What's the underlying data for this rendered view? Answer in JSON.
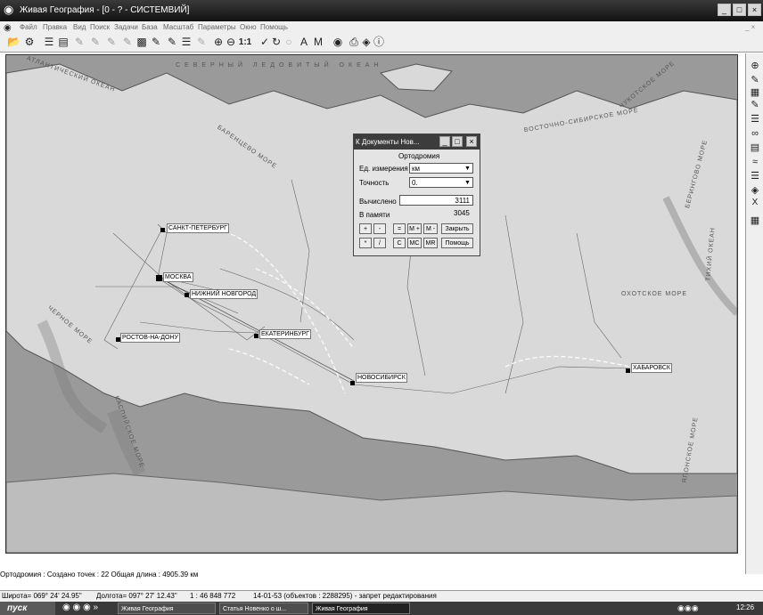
{
  "window": {
    "title": "Живая География - [0 - ? - СИСТЕМВИЙ]"
  },
  "menu": [
    "Файл",
    "Правка",
    "Вид",
    "Поиск",
    "Задачи",
    "База",
    "Масштаб",
    "Параметры",
    "Окно",
    "Помощь"
  ],
  "toolbar": {
    "zoom_label": "1:1"
  },
  "map": {
    "cities": [
      {
        "name": "САНКТ-ПЕТЕРБУРГ"
      },
      {
        "name": "МОСКВА"
      },
      {
        "name": "НИЖНИЙ НОВГОРОД"
      },
      {
        "name": "РОСТОВ-НА-ДОНУ"
      },
      {
        "name": "ЕКАТЕРИНБУРГ"
      },
      {
        "name": "НОВОСИБИРСК"
      },
      {
        "name": "ХАБАРОВСК"
      }
    ],
    "seas": [
      "АТЛАНТИЧЕСКИЙ ОКЕАН",
      "ВОСТОЧНО-СИБИРСКОЕ МОРЕ",
      "ОХОТСКОЕ МОРЕ",
      "ТИХИЙ ОКЕАН",
      "ЧУКОТСКОЕ МОРЕ",
      "БЕРИНГОВО МОРЕ",
      "ЧЕРНОЕ МОРЕ",
      "КАСПИЙСКОЕ МОРЕ",
      "ЯПОНСКОЕ МОРЕ",
      "СЕВЕРНЫЙ ЛЕДОВИТЫЙ ОКЕАН",
      "БАРЕНЦЕВО МОРЕ"
    ]
  },
  "dialog": {
    "title": "К Документы Нов...",
    "group": "Ортодромия",
    "unit_label": "Ед. измерения",
    "unit_value": "км",
    "precision_label": "Точность",
    "precision_value": "0.",
    "computed_label": "Вычислено",
    "computed_value": "3111",
    "memory_label": "В памяти",
    "memory_value": "3045",
    "buttons_row1": [
      "+",
      "-",
      "=",
      "M +",
      "M -",
      "Закрыть"
    ],
    "buttons_row2": [
      "*",
      "/",
      "C",
      "MC",
      "MR",
      "Помощь"
    ]
  },
  "status": {
    "line1": "Ортодромия : Создано точек :  22   Общая длина :  4905.39  км",
    "lat": "Широта= 069° 24' 24.95\"",
    "lon": "Долгота= 097° 27' 12.43\"",
    "scale": "1 : 46 848 772",
    "info": "14-01-53  (объектов : 2288295) - запрет редактирования"
  },
  "taskbar": {
    "start": "пуск",
    "tasks": [
      "Живая География",
      "Статья Новенко о ш...",
      "Живая География"
    ],
    "clock": "12:26"
  }
}
